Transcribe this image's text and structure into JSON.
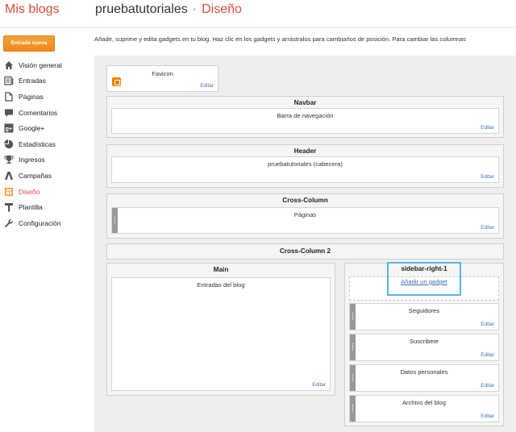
{
  "header": {
    "app_title": "Mis blogs",
    "blog_name": "pruebatutoriales",
    "separator": "·",
    "section": "Diseño"
  },
  "new_post_label": "Entrada nueva",
  "nav": [
    {
      "label": "Visión general",
      "icon": "home-icon"
    },
    {
      "label": "Entradas",
      "icon": "posts-icon"
    },
    {
      "label": "Páginas",
      "icon": "pages-icon"
    },
    {
      "label": "Comentarios",
      "icon": "comment-icon"
    },
    {
      "label": "Google+",
      "icon": "googleplus-icon"
    },
    {
      "label": "Estadísticas",
      "icon": "stats-icon"
    },
    {
      "label": "Ingresos",
      "icon": "trophy-icon"
    },
    {
      "label": "Campañas",
      "icon": "campaign-icon"
    },
    {
      "label": "Diseño",
      "icon": "layout-icon",
      "active": true
    },
    {
      "label": "Plantilla",
      "icon": "template-icon"
    },
    {
      "label": "Configuración",
      "icon": "wrench-icon"
    }
  ],
  "intro_text": "Añade, suprime y edita gadgets en tu blog. Haz clic en los gadgets y arrástralos para cambiarlos de posición. Para cambiar las columnas",
  "layout": {
    "favicon": {
      "title": "Favicon",
      "edit": "Editar"
    },
    "navbar": {
      "title": "Navbar",
      "gadget": "Barra de navegación",
      "edit": "Editar"
    },
    "header": {
      "title": "Header",
      "gadget": "pruebatutoriales (cabecera)",
      "edit": "Editar"
    },
    "cross_column": {
      "title": "Cross-Column",
      "gadget": "Páginas",
      "edit": "Editar"
    },
    "cross_column_2": {
      "title": "Cross-Column 2"
    },
    "main": {
      "title": "Main",
      "gadget": "Entradas del blog",
      "edit": "Editar"
    },
    "sidebar": {
      "title": "sidebar-right-1",
      "add_gadget": "Añadir un gadget",
      "gadgets": [
        {
          "title": "Seguidores",
          "edit": "Editar"
        },
        {
          "title": "Suscribete",
          "edit": "Editar"
        },
        {
          "title": "Datos personales",
          "edit": "Editar"
        },
        {
          "title": "Archivo del blog",
          "edit": "Editar"
        }
      ]
    }
  },
  "colors": {
    "accent": "#dd4b39",
    "button": "#f39425",
    "link": "#3d6fb6",
    "highlight": "#55b6e6"
  }
}
